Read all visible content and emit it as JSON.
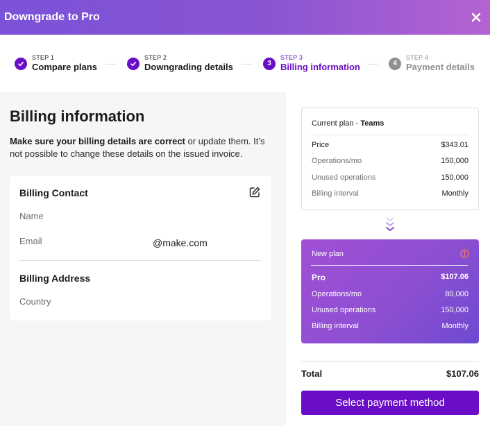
{
  "header": {
    "title": "Downgrade to Pro",
    "close_icon": "close-icon"
  },
  "stepper": {
    "steps": [
      {
        "kicker": "STEP 1",
        "label": "Compare plans",
        "state": "done",
        "marker": "check"
      },
      {
        "kicker": "STEP 2",
        "label": "Downgrading details",
        "state": "done",
        "marker": "check"
      },
      {
        "kicker": "STEP 3",
        "label": "Billing information",
        "state": "active",
        "marker": "3"
      },
      {
        "kicker": "STEP 4",
        "label": "Payment details",
        "state": "pending",
        "marker": "4"
      }
    ]
  },
  "billing": {
    "title": "Billing information",
    "desc_bold": "Make sure your billing details are correct",
    "desc_rest": " or update them. It’s not possible to change these details on the issued invoice.",
    "contact": {
      "heading": "Billing Contact",
      "edit_icon": "edit-icon",
      "name_label": "Name",
      "name_value": "",
      "email_label": "Email",
      "email_value": "@make.com"
    },
    "address": {
      "heading": "Billing Address",
      "country_label": "Country",
      "country_value": ""
    }
  },
  "current_plan": {
    "label": "Current plan - ",
    "name": "Teams",
    "rows": [
      {
        "label": "Price",
        "value": "$343.01"
      },
      {
        "label": "Operations/mo",
        "value": "150,000"
      },
      {
        "label": "Unused operations",
        "value": "150,000"
      },
      {
        "label": "Billing interval",
        "value": "Monthly"
      }
    ]
  },
  "new_plan": {
    "label": "New plan",
    "info_icon": "info-icon",
    "name": "Pro",
    "price": "$107.06",
    "rows": [
      {
        "label": "Operations/mo",
        "value": "80,000"
      },
      {
        "label": "Unused operations",
        "value": "150,000"
      },
      {
        "label": "Billing interval",
        "value": "Monthly"
      }
    ]
  },
  "summary": {
    "total_label": "Total",
    "total_value": "$107.06",
    "button_label": "Select payment method"
  },
  "colors": {
    "accent": "#6a0dc7",
    "header_gradient_start": "#7b52d8",
    "header_gradient_end": "#b463d1",
    "new_plan_gradient_start": "#a04fd6",
    "new_plan_gradient_end": "#6c4ad0",
    "pending": "#909090",
    "info_icon": "#ff7a59"
  }
}
